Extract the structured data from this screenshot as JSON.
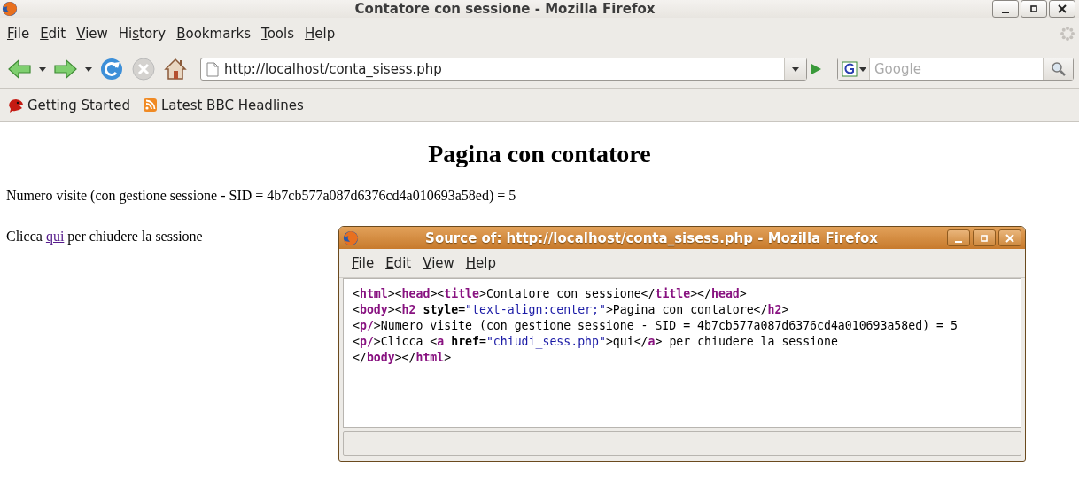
{
  "window": {
    "title": "Contatore con sessione - Mozilla Firefox"
  },
  "menu": [
    {
      "key": "F",
      "rest": "ile"
    },
    {
      "key": "E",
      "rest": "dit"
    },
    {
      "key": "V",
      "rest": "iew"
    },
    {
      "before": "Hi",
      "key": "s",
      "rest": "tory"
    },
    {
      "key": "B",
      "rest": "ookmarks"
    },
    {
      "key": "T",
      "rest": "ools"
    },
    {
      "key": "H",
      "rest": "elp"
    }
  ],
  "toolbar": {
    "url": "http://localhost/conta_sisess.php",
    "search_placeholder": "Google"
  },
  "bookmarks": [
    {
      "label": "Getting Started",
      "kind": "page"
    },
    {
      "label": "Latest BBC Headlines",
      "kind": "feed"
    }
  ],
  "page": {
    "heading": "Pagina con contatore",
    "paragraphs": [
      {
        "before": "Numero visite (con gestione sessione - SID = 4b7cb577a087d6376cd4a010693a58ed) = 5"
      },
      {
        "before": "Clicca ",
        "link": "qui",
        "after": " per chiudere la sessione"
      }
    ]
  },
  "source_window": {
    "title": "Source of: http://localhost/conta_sisess.php - Mozilla Firefox",
    "menu": [
      {
        "key": "F",
        "rest": "ile"
      },
      {
        "key": "E",
        "rest": "dit"
      },
      {
        "key": "V",
        "rest": "iew"
      },
      {
        "key": "H",
        "rest": "elp"
      }
    ],
    "lines": [
      [
        {
          "kind": "text",
          "text": "<"
        },
        {
          "kind": "tag",
          "text": "html"
        },
        {
          "kind": "text",
          "text": "><"
        },
        {
          "kind": "tag",
          "text": "head"
        },
        {
          "kind": "text",
          "text": "><"
        },
        {
          "kind": "tag",
          "text": "title"
        },
        {
          "kind": "text",
          "text": ">Contatore con sessione</"
        },
        {
          "kind": "tag",
          "text": "title"
        },
        {
          "kind": "text",
          "text": "></"
        },
        {
          "kind": "tag",
          "text": "head"
        },
        {
          "kind": "text",
          "text": ">"
        }
      ],
      [
        {
          "kind": "text",
          "text": "<"
        },
        {
          "kind": "tag",
          "text": "body"
        },
        {
          "kind": "text",
          "text": "><"
        },
        {
          "kind": "tag",
          "text": "h2"
        },
        {
          "kind": "attr",
          "text": " style"
        },
        {
          "kind": "text",
          "text": "="
        },
        {
          "kind": "value",
          "text": "\"text-align:center;\""
        },
        {
          "kind": "text",
          "text": ">Pagina con contatore</"
        },
        {
          "kind": "tag",
          "text": "h2"
        },
        {
          "kind": "text",
          "text": ">"
        }
      ],
      [
        {
          "kind": "text",
          "text": "<"
        },
        {
          "kind": "tag",
          "text": "p/"
        },
        {
          "kind": "text",
          "text": ">Numero visite (con gestione sessione - SID = 4b7cb577a087d6376cd4a010693a58ed) = 5"
        }
      ],
      [
        {
          "kind": "text",
          "text": "<"
        },
        {
          "kind": "tag",
          "text": "p/"
        },
        {
          "kind": "text",
          "text": ">Clicca <"
        },
        {
          "kind": "tag",
          "text": "a"
        },
        {
          "kind": "attr",
          "text": " href"
        },
        {
          "kind": "text",
          "text": "="
        },
        {
          "kind": "value",
          "text": "\"chiudi_sess.php\""
        },
        {
          "kind": "text",
          "text": ">qui</"
        },
        {
          "kind": "tag",
          "text": "a"
        },
        {
          "kind": "text",
          "text": "> per chiudere la sessione"
        }
      ],
      [
        {
          "kind": "text",
          "text": "</"
        },
        {
          "kind": "tag",
          "text": "body"
        },
        {
          "kind": "text",
          "text": "></"
        },
        {
          "kind": "tag",
          "text": "html"
        },
        {
          "kind": "text",
          "text": ">"
        }
      ]
    ]
  }
}
